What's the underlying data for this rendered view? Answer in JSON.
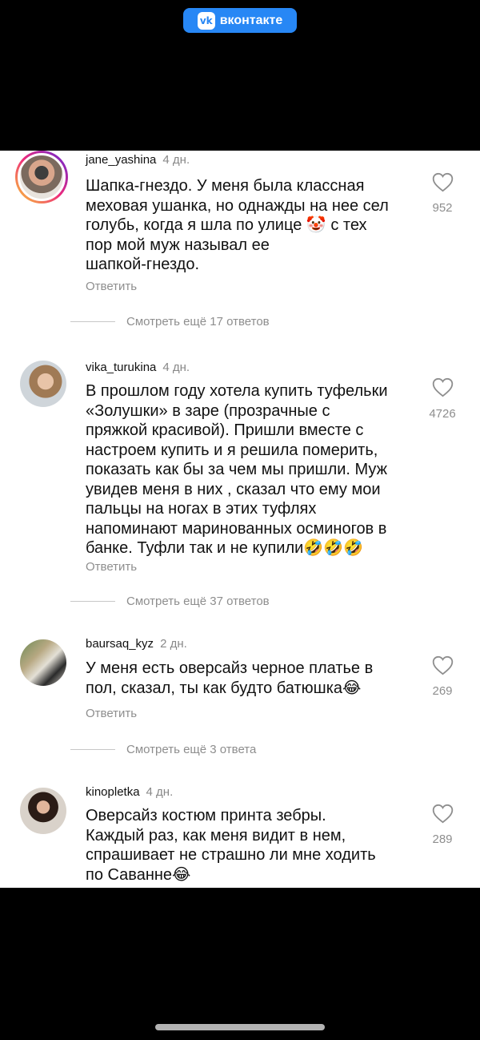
{
  "header": {
    "logo_text": "vk",
    "brand": "вконтакте",
    "brand_color": "#2787F5"
  },
  "comments": [
    {
      "username": "jane_yashina",
      "time": "4 дн.",
      "text": "Шапка-гнездо. У меня была классная меховая ушанка, но однажды на нее сел голубь, когда я шла по улице 🤡 с тех пор мой муж называл ее шапкой-гнездо.",
      "lines": [
        "Шапка-гнездо. У меня была классная",
        "меховая ушанка, но однажды на нее сел",
        "голубь, когда я шла по улице 🤡 с тех",
        "пор мой муж называл ее",
        "шапкой-гнездо."
      ],
      "likes": "952",
      "reply": "Ответить",
      "more": "Смотреть ещё 17 ответов"
    },
    {
      "username": "vika_turukina",
      "time": "4 дн.",
      "lines": [
        "В прошлом году хотела купить туфельки",
        "«Золушки» в заре (прозрачные с",
        "пряжкой красивой). Пришли вместе с",
        "настроем купить и я решила померить,",
        "показать как бы за чем мы пришли. Муж",
        "увидев меня в них , сказал что ему мои",
        "пальцы на ногах в этих туфлях",
        "напоминают маринованных осминогов в",
        "банке. Туфли так и не купили🤣🤣🤣"
      ],
      "likes": "4726",
      "reply": "Ответить",
      "more": "Смотреть ещё 37 ответов"
    },
    {
      "username": "baursaq_kyz",
      "time": "2 дн.",
      "lines": [
        "У меня есть оверсайз черное платье в",
        "пол, сказал, ты как будто батюшка😂"
      ],
      "likes": "269",
      "reply": "Ответить",
      "more": "Смотреть ещё 3 ответа"
    },
    {
      "username": "kinopletka",
      "time": "4 дн.",
      "lines": [
        "Оверсайз костюм принта зебры.",
        "Каждый раз, как меня видит в нем,",
        "спрашивает не страшно ли мне ходить",
        "по Саванне😂"
      ],
      "likes": "289"
    }
  ]
}
